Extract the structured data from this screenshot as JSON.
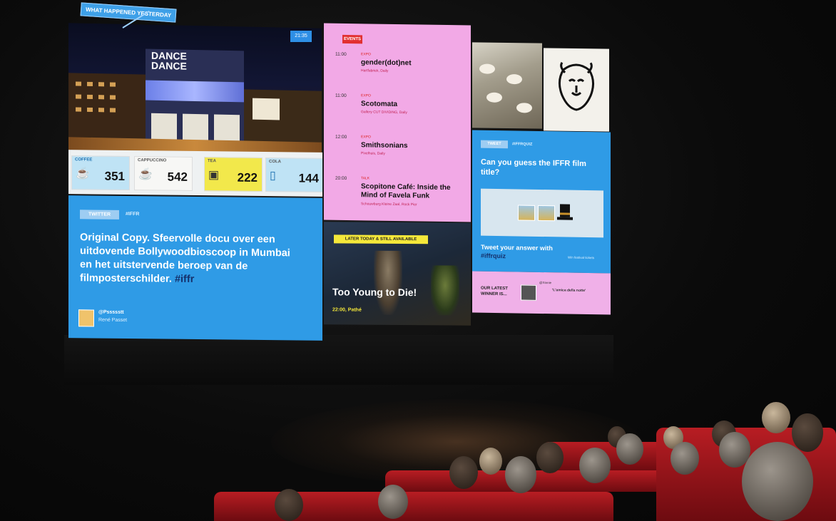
{
  "scene": "Cinema auditorium with a large screen showing an IFFR festival dashboard",
  "photo_tile": {
    "tag": "WHAT HAPPENED YESTERDAY",
    "time": "21:35",
    "sign": "DANCE DANCE"
  },
  "drinks": [
    {
      "label": "COFFEE",
      "value": "351",
      "icon": "cup-icon"
    },
    {
      "label": "CAPPUCCINO",
      "value": "542",
      "icon": "cup-icon"
    },
    {
      "label": "TEA",
      "value": "222",
      "icon": "teabag-icon"
    },
    {
      "label": "COLA",
      "value": "144",
      "icon": "glass-icon"
    }
  ],
  "twitter_tile": {
    "chip": "TWITTER",
    "hashtag": "#IFFR",
    "tweet_main": "Original Copy. Sfeervolle docu over een uitdovende Bollywoodbioscoop in Mumbai en het uitstervende beroep van de filmposterschilder.",
    "tweet_tag": "#iffr",
    "handle": "@Pssssstt",
    "name": "René Passet"
  },
  "events_tile": {
    "badge": "EVENTS",
    "items": [
      {
        "time": "11:00",
        "cat": "EXPO",
        "title": "gender(dot)net",
        "place": "Hartfabriek, Daily"
      },
      {
        "time": "11:00",
        "cat": "EXPO",
        "title": "Scotomata",
        "place": "Gallery CUT DIVIDING, Daily"
      },
      {
        "time": "12:00",
        "cat": "EXPO",
        "title": "Smithsonians",
        "place": "Pixelhuis, Daily"
      },
      {
        "time": "20:00",
        "cat": "TALK",
        "title": "Scopitone Café: Inside the Mind of Favela Funk",
        "place": "Schouwburg Kleine Zaal, Rock Pier"
      }
    ]
  },
  "trailer_tile": {
    "badge": "LATER TODAY & STILL AVAILABLE",
    "title": "Too Young to Die!",
    "time": "22:00, Pathé"
  },
  "quiz_tile": {
    "chip": "TWEET",
    "hashtag": "#IFFRQUIZ",
    "question": "Can you guess the IFFR film title?",
    "answer_main": "Tweet your answer with",
    "answer_tag": "#iffrquiz",
    "small": "Win festival tickets"
  },
  "winner_tile": {
    "label": "OUR LATEST WINNER IS...",
    "handle": "@Xinnie",
    "quote": "'L'amica della notte'"
  }
}
